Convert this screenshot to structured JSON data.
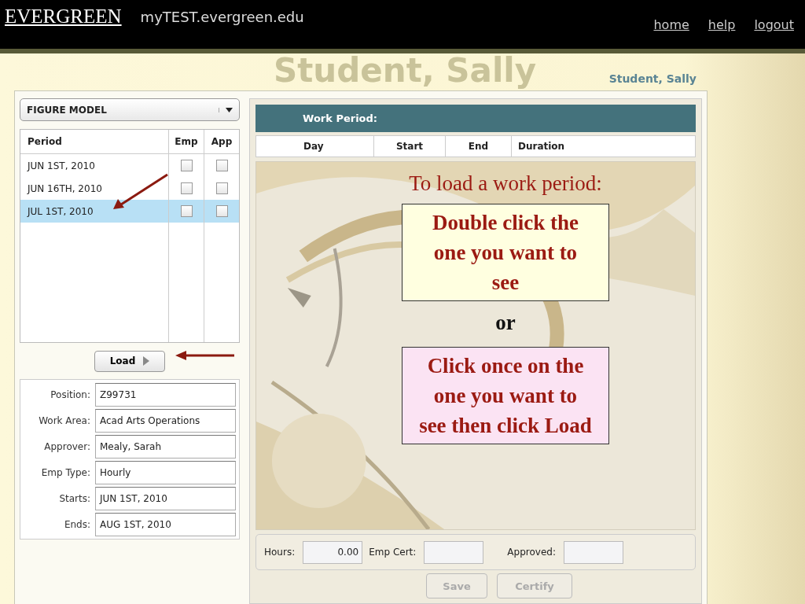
{
  "header": {
    "logo": "EVERGREEN",
    "site": "myTEST.evergreen.edu",
    "links": [
      "home",
      "help",
      "logout"
    ]
  },
  "banner_name": "Student, Sally",
  "user_name": "Student, Sally",
  "dropdown": {
    "value": "FIGURE MODEL"
  },
  "periods": {
    "columns": [
      "Period",
      "Emp",
      "App"
    ],
    "rows": [
      {
        "period": "JUN 1ST, 2010",
        "emp": false,
        "app": false,
        "selected": false
      },
      {
        "period": "JUN 16TH, 2010",
        "emp": false,
        "app": false,
        "selected": false
      },
      {
        "period": "JUL 1ST, 2010",
        "emp": false,
        "app": false,
        "selected": true
      }
    ]
  },
  "load_button": "Load",
  "details": [
    {
      "label": "Position:",
      "value": "Z99731"
    },
    {
      "label": "Work Area:",
      "value": "Acad Arts Operations"
    },
    {
      "label": "Approver:",
      "value": "Mealy, Sarah"
    },
    {
      "label": "Emp Type:",
      "value": "Hourly"
    },
    {
      "label": "Starts:",
      "value": "JUN 1ST, 2010"
    },
    {
      "label": "Ends:",
      "value": "AUG 1ST, 2010"
    }
  ],
  "work_period": {
    "title": "Work Period:",
    "columns": [
      "Day",
      "Start",
      "End",
      "Duration"
    ]
  },
  "annotations": {
    "heading": "To load a work period:",
    "or": "or",
    "notes": [
      {
        "text": "Double click the one you want to see",
        "color": "#ffffe0"
      },
      {
        "text": "Click once on the one you want to see then click Load",
        "color": "#fbe3f3"
      }
    ]
  },
  "totals": [
    {
      "label": "Hours:",
      "value": "0.00"
    },
    {
      "label": "Emp Cert:"
    },
    {
      "label": "Approved:"
    }
  ],
  "buttons": [
    {
      "label": "Save",
      "disabled": true
    },
    {
      "label": "Certify",
      "disabled": true
    }
  ]
}
